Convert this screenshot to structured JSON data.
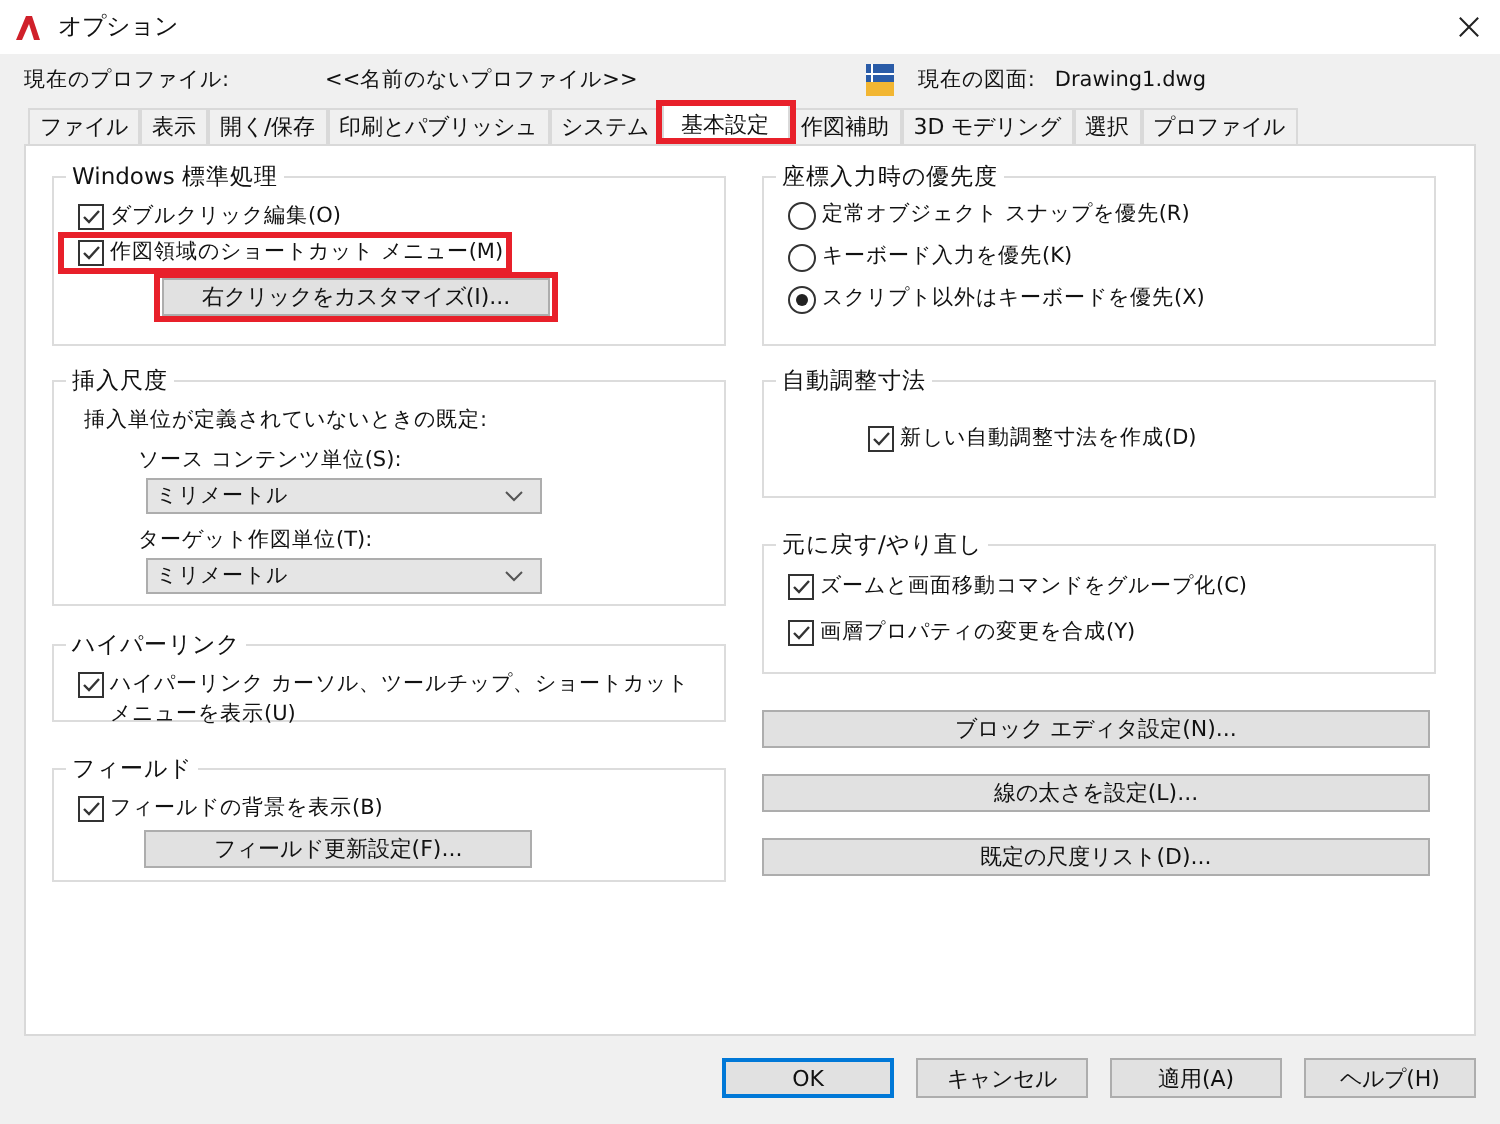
{
  "window": {
    "title": "オプション"
  },
  "profile": {
    "label": "現在のプロファイル:",
    "value": "<<名前のないプロファイル>>"
  },
  "drawing": {
    "label": "現在の図面:",
    "value": "Drawing1.dwg"
  },
  "tabs": [
    {
      "label": "ファイル",
      "selected": false,
      "highlighted": false
    },
    {
      "label": "表示",
      "selected": false,
      "highlighted": false
    },
    {
      "label": "開く/保存",
      "selected": false,
      "highlighted": false
    },
    {
      "label": "印刷とパブリッシュ",
      "selected": false,
      "highlighted": false
    },
    {
      "label": "システム",
      "selected": false,
      "highlighted": false
    },
    {
      "label": "基本設定",
      "selected": true,
      "highlighted": true
    },
    {
      "label": "作図補助",
      "selected": false,
      "highlighted": false
    },
    {
      "label": "3D モデリング",
      "selected": false,
      "highlighted": false
    },
    {
      "label": "選択",
      "selected": false,
      "highlighted": false
    },
    {
      "label": "プロファイル",
      "selected": false,
      "highlighted": false
    }
  ],
  "left_groups": [
    {
      "title": "Windows 標準処理",
      "items": [
        {
          "kind": "checkbox",
          "label": "ダブルクリック編集(O)",
          "checked": true,
          "highlighted": false
        },
        {
          "kind": "checkbox",
          "label": "作図領域のショートカット メニュー(M)",
          "checked": true,
          "highlighted": true
        },
        {
          "kind": "button",
          "label": "右クリックをカスタマイズ(I)...",
          "highlighted": true
        }
      ]
    },
    {
      "title": "挿入尺度",
      "items": [
        {
          "kind": "note",
          "label": "挿入単位が定義されていないときの既定:"
        },
        {
          "kind": "field-label",
          "label": "ソース コンテンツ単位(S):"
        },
        {
          "kind": "select",
          "value": "ミリメートル"
        },
        {
          "kind": "field-label",
          "label": "ターゲット作図単位(T):"
        },
        {
          "kind": "select",
          "value": "ミリメートル"
        }
      ]
    },
    {
      "title": "ハイパーリンク",
      "items": [
        {
          "kind": "checkbox",
          "label": "ハイパーリンク カーソル、ツールチップ、ショートカットメニューを表示(U)",
          "checked": true,
          "highlighted": false
        }
      ]
    },
    {
      "title": "フィールド",
      "items": [
        {
          "kind": "checkbox",
          "label": "フィールドの背景を表示(B)",
          "checked": true,
          "highlighted": false
        },
        {
          "kind": "button",
          "label": "フィールド更新設定(F)...",
          "highlighted": false
        }
      ]
    }
  ],
  "right_groups": [
    {
      "title": "座標入力時の優先度",
      "items": [
        {
          "kind": "radio",
          "label": "定常オブジェクト スナップを優先(R)",
          "selected": false
        },
        {
          "kind": "radio",
          "label": "キーボード入力を優先(K)",
          "selected": false
        },
        {
          "kind": "radio",
          "label": "スクリプト以外はキーボードを優先(X)",
          "selected": true
        }
      ]
    },
    {
      "title": "自動調整寸法",
      "items": [
        {
          "kind": "checkbox-inset",
          "label": "新しい自動調整寸法を作成(D)",
          "checked": true,
          "highlighted": false
        }
      ]
    },
    {
      "title": "元に戻す/やり直し",
      "items": [
        {
          "kind": "checkbox",
          "label": "ズームと画面移動コマンドをグループ化(C)",
          "checked": true,
          "highlighted": false
        },
        {
          "kind": "checkbox",
          "label": "画層プロパティの変更を合成(Y)",
          "checked": true,
          "highlighted": false
        }
      ]
    }
  ],
  "right_buttons": [
    "ブロック エディタ設定(N)...",
    "線の太さを設定(L)...",
    "既定の尺度リスト(D)..."
  ],
  "footer_buttons": [
    {
      "label": "OK",
      "default": true
    },
    {
      "label": "キャンセル",
      "default": false
    },
    {
      "label": "適用(A)",
      "default": false
    },
    {
      "label": "ヘルプ(H)",
      "default": false
    }
  ]
}
